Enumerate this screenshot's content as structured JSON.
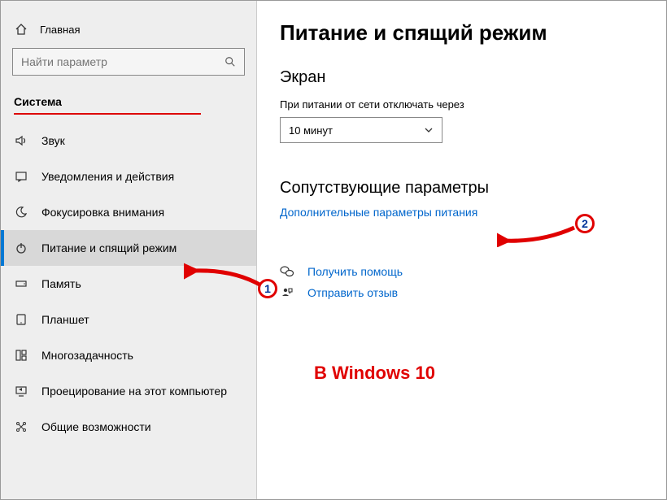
{
  "sidebar": {
    "home_label": "Главная",
    "search_placeholder": "Найти параметр",
    "section_label": "Система",
    "items": [
      {
        "label": "Звук"
      },
      {
        "label": "Уведомления и действия"
      },
      {
        "label": "Фокусировка внимания"
      },
      {
        "label": "Питание и спящий режим"
      },
      {
        "label": "Память"
      },
      {
        "label": "Планшет"
      },
      {
        "label": "Многозадачность"
      },
      {
        "label": "Проецирование на этот компьютер"
      },
      {
        "label": "Общие возможности"
      }
    ]
  },
  "main": {
    "title": "Питание и спящий режим",
    "screen_heading": "Экран",
    "screen_field_label": "При питании от сети отключать через",
    "screen_dropdown_value": "10 минут",
    "related_heading": "Сопутствующие параметры",
    "related_link": "Дополнительные параметры питания",
    "help_link": "Получить помощь",
    "feedback_link": "Отправить отзыв"
  },
  "annotations": {
    "badge1": "1",
    "badge2": "2",
    "caption": "В Windows 10"
  }
}
